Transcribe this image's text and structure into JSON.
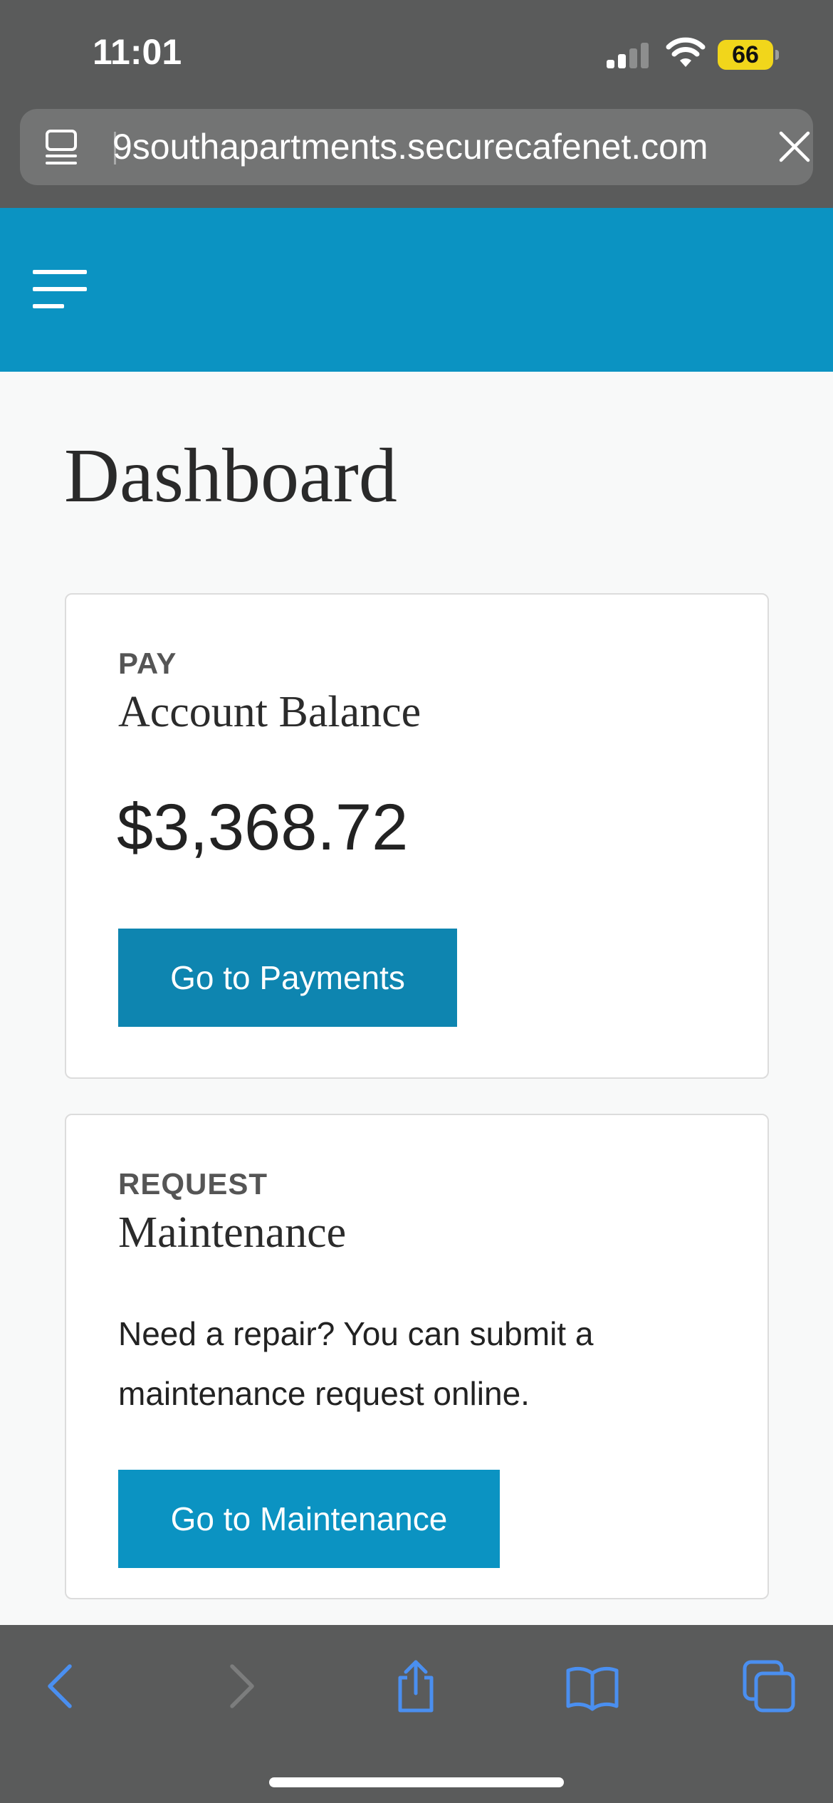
{
  "status_bar": {
    "time": "11:01",
    "battery": "66"
  },
  "browser": {
    "url": "9southapartments.securecafenet.com"
  },
  "page": {
    "title": "Dashboard"
  },
  "cards": {
    "pay": {
      "eyebrow": "PAY",
      "heading": "Account Balance",
      "balance": "$3,368.72",
      "button": "Go to Payments"
    },
    "maintenance": {
      "eyebrow": "REQUEST",
      "heading": "Maintenance",
      "description": "Need a repair? You can submit a maintenance request online.",
      "button": "Go to Maintenance"
    }
  },
  "toolbar": {
    "icons": [
      "back-icon",
      "forward-icon",
      "share-icon",
      "bookmarks-icon",
      "tabs-icon"
    ]
  },
  "colors": {
    "brand": "#0b93c2",
    "button_pay": "#0e85b0",
    "chrome": "#5a5b5b",
    "toolbar_accent": "#4a8ff0"
  }
}
